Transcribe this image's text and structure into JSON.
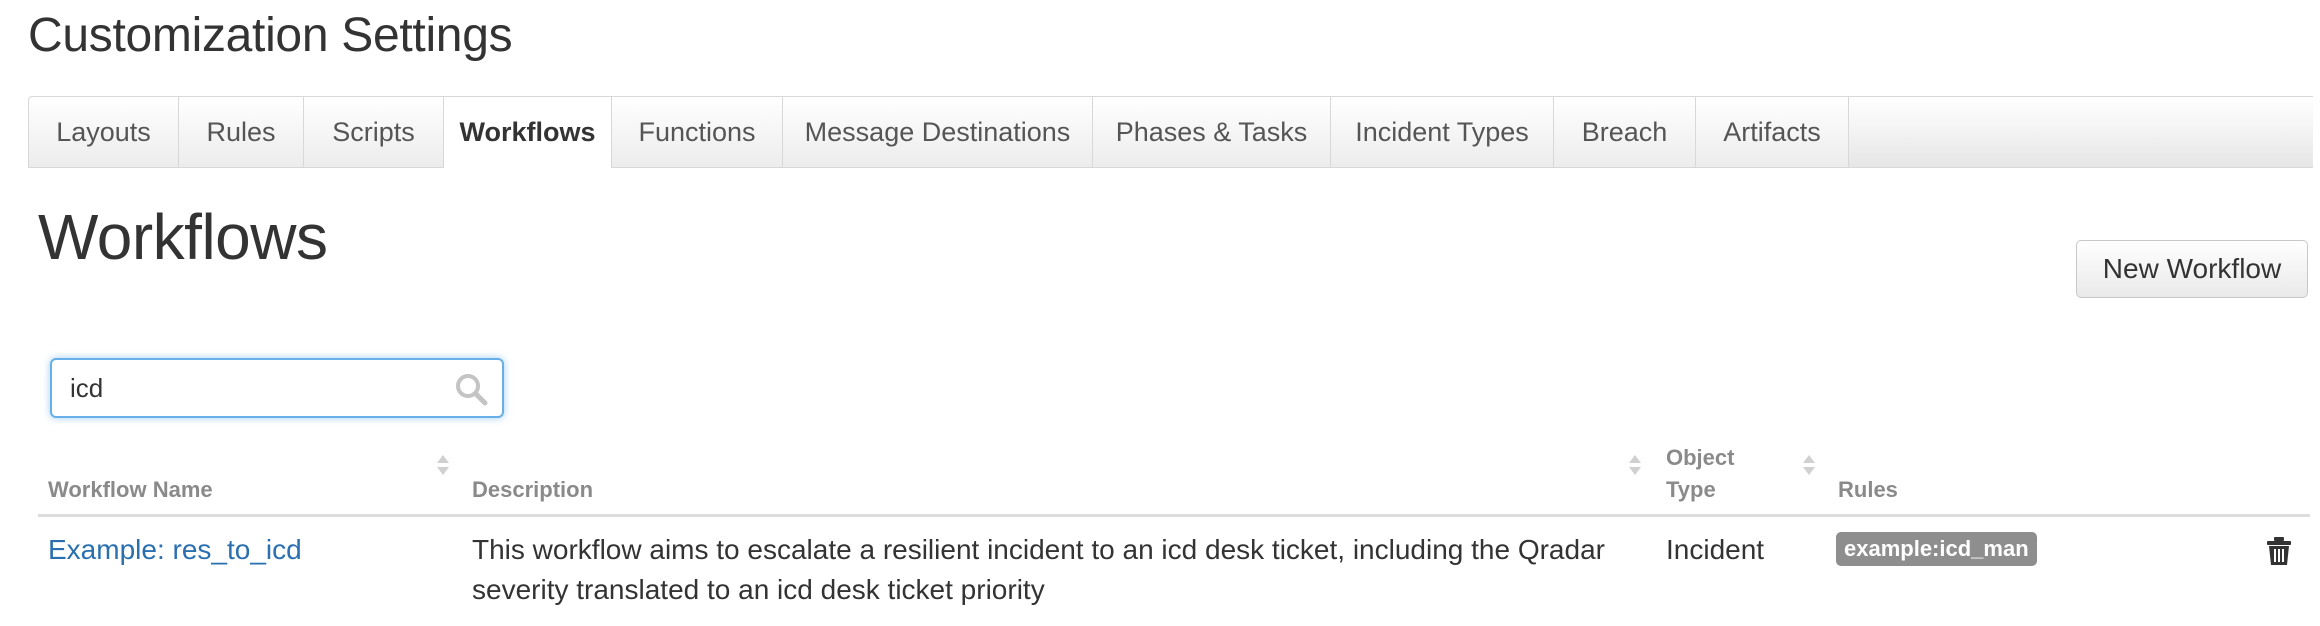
{
  "page": {
    "title": "Customization Settings"
  },
  "tabs": [
    {
      "label": "Layouts",
      "active": false
    },
    {
      "label": "Rules",
      "active": false
    },
    {
      "label": "Scripts",
      "active": false
    },
    {
      "label": "Workflows",
      "active": true
    },
    {
      "label": "Functions",
      "active": false
    },
    {
      "label": "Message Destinations",
      "active": false
    },
    {
      "label": "Phases & Tasks",
      "active": false
    },
    {
      "label": "Incident Types",
      "active": false
    },
    {
      "label": "Breach",
      "active": false
    },
    {
      "label": "Artifacts",
      "active": false
    }
  ],
  "section": {
    "title": "Workflows",
    "new_button_label": "New Workflow"
  },
  "search": {
    "value": "icd",
    "icon": "search-icon"
  },
  "table": {
    "headers": {
      "name": "Workflow Name",
      "description": "Description",
      "object_type_line1": "Object",
      "object_type_line2": "Type",
      "rules": "Rules"
    },
    "rows": [
      {
        "name": "Example: res_to_icd",
        "description_line1": "This workflow aims to escalate a resilient incident to an icd desk ticket, including the Qradar",
        "description_line2": "severity translated to an icd desk ticket priority",
        "object_type": "Incident",
        "rule": "example:icd_man",
        "delete_icon": "trash-icon"
      }
    ]
  },
  "colors": {
    "link": "#2a6fb0",
    "focus_border": "#66afe9",
    "badge_bg": "#8e8e8e",
    "header_text": "#8a8a8a"
  }
}
